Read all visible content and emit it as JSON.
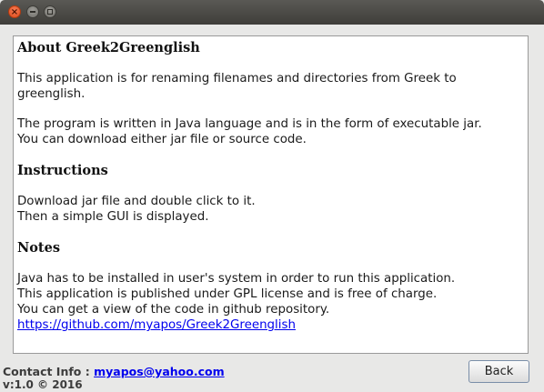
{
  "window": {
    "controls": {
      "close_glyph": "×",
      "close_icon": "close-icon",
      "minimize_icon": "minimize-icon",
      "maximize_icon": "maximize-icon"
    }
  },
  "content": {
    "about": {
      "heading": "About Greek2Greenglish",
      "p1_lines": [
        "This application is for renaming filenames and directories from Greek to",
        "greenglish."
      ],
      "p2_lines": [
        "The program is written in Java language and is in the form of executable jar.",
        "You can download either jar file or source code."
      ]
    },
    "instructions": {
      "heading": "Instructions",
      "lines": [
        "Download jar file and double click to it.",
        "Then a simple GUI is displayed."
      ]
    },
    "notes": {
      "heading": "Notes",
      "lines": [
        "Java has to be installed in user's system in order to run this application.",
        "This application is published under GPL license and is free of charge.",
        "You can get a view of the code in github repository."
      ],
      "link": "https://github.com/myapos/Greek2Greenglish"
    }
  },
  "footer": {
    "contact_label": "Contact Info :",
    "contact_email": "myapos@yahoo.com",
    "version": "v:1.0 © 2016",
    "back_label": "Back"
  },
  "colors": {
    "link": "#0000ee",
    "titlebar": "#4a4945",
    "close_button": "#e5531f",
    "window_background": "#e8e8e7"
  }
}
